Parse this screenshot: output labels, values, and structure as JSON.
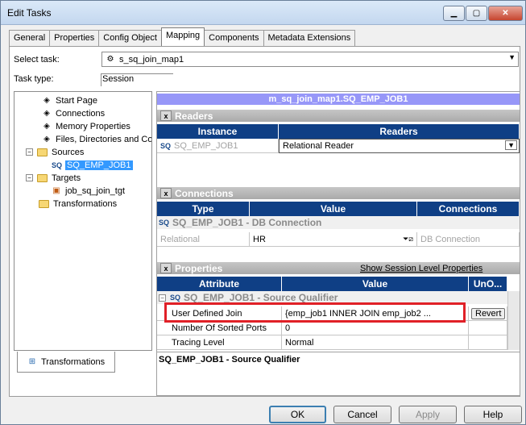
{
  "window": {
    "title": "Edit Tasks"
  },
  "tabs": [
    "General",
    "Properties",
    "Config Object",
    "Mapping",
    "Components",
    "Metadata Extensions"
  ],
  "select_task": {
    "label": "Select task:",
    "value": "s_sq_join_map1"
  },
  "task_type": {
    "label": "Task type:",
    "value": "Session"
  },
  "tree": {
    "items": [
      "Start Page",
      "Connections",
      "Memory Properties",
      "Files, Directories and Com",
      "Sources",
      "SQ_EMP_JOB1",
      "Targets",
      "job_sq_join_tgt",
      "Transformations"
    ],
    "bottom_tab": "Transformations"
  },
  "mapping_title": "m_sq_join_map1.SQ_EMP_JOB1",
  "readers": {
    "section": "Readers",
    "headers": [
      "Instance",
      "Readers"
    ],
    "row": {
      "instance": "SQ_EMP_JOB1",
      "reader": "Relational Reader"
    }
  },
  "connections": {
    "section": "Connections",
    "headers": [
      "Type",
      "Value",
      "Connections"
    ],
    "group": "SQ_EMP_JOB1 - DB Connection",
    "row": {
      "type": "Relational",
      "value": "HR",
      "connection": "DB Connection"
    }
  },
  "properties": {
    "section": "Properties",
    "show_link": "Show Session Level Properties",
    "headers": [
      "Attribute",
      "Value",
      "UnO..."
    ],
    "group": "SQ_EMP_JOB1 - Source Qualifier",
    "rows": [
      {
        "attribute": "User Defined Join",
        "value": "{emp_job1 INNER JOIN emp_job2 ...",
        "action": "Revert"
      },
      {
        "attribute": "Number Of Sorted Ports",
        "value": "0",
        "action": ""
      },
      {
        "attribute": "Tracing Level",
        "value": "Normal",
        "action": ""
      }
    ]
  },
  "description": "SQ_EMP_JOB1 - Source Qualifier",
  "buttons": {
    "ok": "OK",
    "cancel": "Cancel",
    "apply": "Apply",
    "help": "Help"
  },
  "icons": [
    "minimize-icon",
    "maximize-icon",
    "close-icon",
    "folder-icon",
    "expand-icon",
    "collapse-icon",
    "dropdown-arrow-icon"
  ],
  "colors": {
    "highlight": "#e02027",
    "header": "#0f3f85",
    "mapping_title": "#9797f8"
  }
}
